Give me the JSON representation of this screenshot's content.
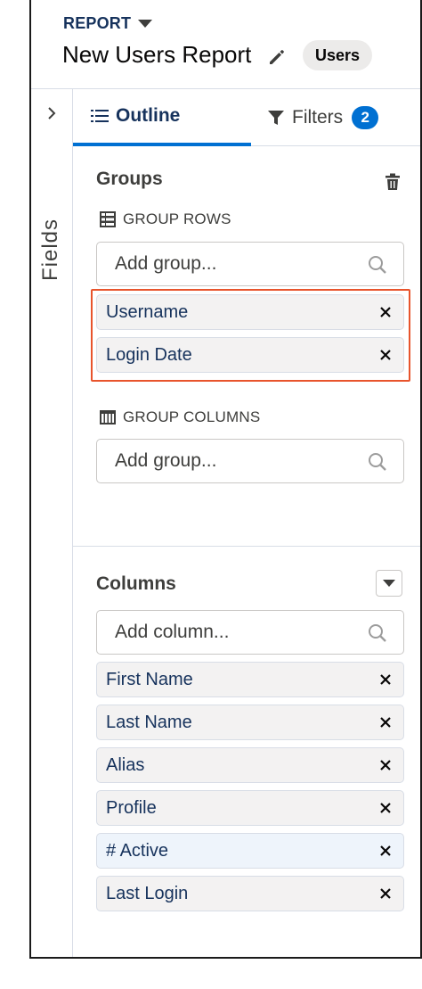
{
  "header": {
    "report_label": "REPORT",
    "title": "New Users Report",
    "object_badge": "Users"
  },
  "rail": {
    "label": "Fields"
  },
  "tabs": {
    "outline": "Outline",
    "filters": "Filters",
    "filters_count": "2"
  },
  "groups": {
    "title": "Groups",
    "rows_label": "GROUP ROWS",
    "rows_placeholder": "Add group...",
    "rows": [
      "Username",
      "Login Date"
    ],
    "columns_label": "GROUP COLUMNS",
    "columns_placeholder": "Add group..."
  },
  "columns": {
    "title": "Columns",
    "placeholder": "Add column...",
    "items": [
      {
        "label": "First Name"
      },
      {
        "label": "Last Name"
      },
      {
        "label": "Alias"
      },
      {
        "label": "Profile"
      },
      {
        "label": "# Active",
        "highlighted": true
      },
      {
        "label": "Last Login"
      }
    ]
  },
  "icons": {
    "outline": "list-icon",
    "filters": "filter-icon",
    "edit": "pencil-icon",
    "delete": "trash-icon",
    "search": "search-icon",
    "remove": "close-icon",
    "expand": "chevron-right-icon"
  },
  "colors": {
    "brand_blue": "#0070d2",
    "highlight_border": "#e8542c",
    "text_navy": "#16325c"
  }
}
